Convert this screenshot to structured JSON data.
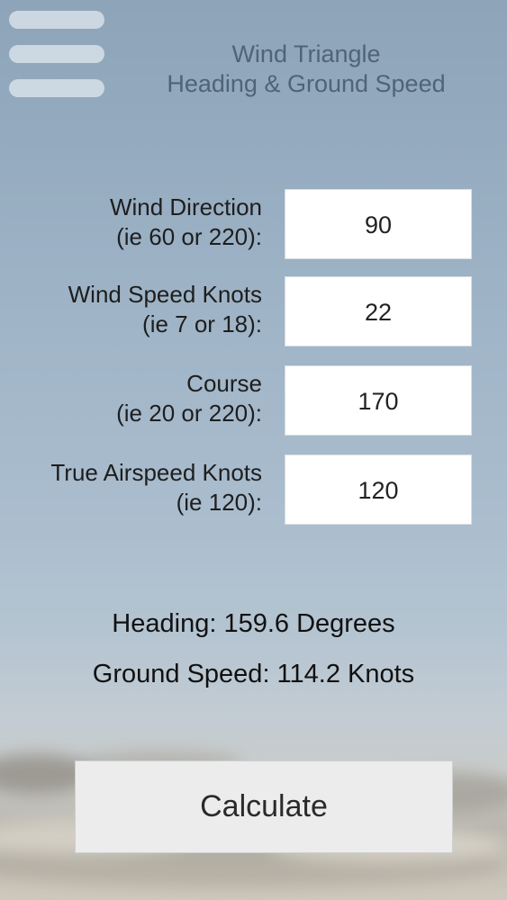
{
  "header": {
    "title_line1": "Wind Triangle",
    "title_line2": "Heading & Ground Speed",
    "menu_icon": "hamburger-menu-icon"
  },
  "form": {
    "wind_direction": {
      "label_line1": "Wind Direction",
      "label_line2": "(ie 60 or 220):",
      "value": "90"
    },
    "wind_speed": {
      "label_line1": "Wind Speed Knots",
      "label_line2": "(ie 7 or 18):",
      "value": "22"
    },
    "course": {
      "label_line1": "Course",
      "label_line2": "(ie 20 or 220):",
      "value": "170"
    },
    "true_airspeed": {
      "label_line1": "True Airspeed Knots",
      "label_line2": "(ie 120):",
      "value": "120"
    }
  },
  "results": {
    "heading": "Heading: 159.6 Degrees",
    "ground_speed": "Ground Speed: 114.2 Knots"
  },
  "actions": {
    "calculate_label": "Calculate"
  }
}
